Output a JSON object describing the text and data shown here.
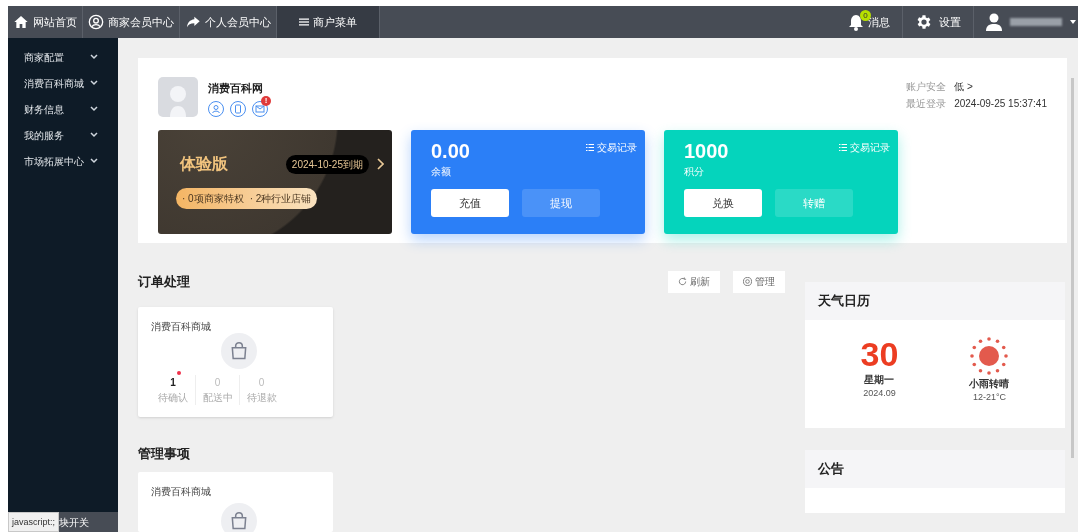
{
  "nav": {
    "left": [
      {
        "label": "网站首页",
        "selected": false
      },
      {
        "label": "商家会员中心",
        "selected": false
      },
      {
        "label": "个人会员中心",
        "selected": false
      },
      {
        "label": "商户菜单",
        "selected": true
      }
    ],
    "messages": {
      "label": "消息",
      "badge": "0"
    },
    "settings": {
      "label": "设置"
    }
  },
  "sidebar": {
    "items": [
      {
        "label": "商家配置"
      },
      {
        "label": "消费百科商城"
      },
      {
        "label": "财务信息"
      },
      {
        "label": "我的服务"
      },
      {
        "label": "市场拓展中心"
      }
    ],
    "bottom_item": "块开关"
  },
  "status_bar": "javascript:;",
  "profile": {
    "name": "消费百科网",
    "mail_alert": "!",
    "security": {
      "label": "账户安全",
      "value": "低 >"
    },
    "last_login": {
      "label": "最近登录",
      "value": "2024-09-25 15:37:41"
    }
  },
  "vip": {
    "title": "体验版",
    "expiry": "2024-10-25到期",
    "perks": [
      "· 0项商家特权",
      "· 2种行业店铺"
    ]
  },
  "wallets": [
    {
      "amount": "0.00",
      "label": "余额",
      "record_link": "交易记录",
      "buttons": [
        "充值",
        "提现"
      ],
      "color": "#2b7ff7"
    },
    {
      "amount": "1000",
      "label": "积分",
      "record_link": "交易记录",
      "buttons": [
        "兑换",
        "转赠"
      ],
      "color": "#05d4bc"
    }
  ],
  "orders": {
    "title": "订单处理",
    "actions": [
      "刷新",
      "管理"
    ],
    "store": "消费百科商城",
    "stats": [
      {
        "value": "1",
        "label": "待确认",
        "alert": true
      },
      {
        "value": "0",
        "label": "配送中",
        "alert": false
      },
      {
        "value": "0",
        "label": "待退款",
        "alert": false
      }
    ]
  },
  "manage": {
    "title": "管理事项",
    "store": "消费百科商城"
  },
  "weather": {
    "title": "天气日历",
    "day": "30",
    "weekday": "星期一",
    "month": "2024.09",
    "condition": "小雨转晴",
    "temperature": "12-21°C"
  },
  "notice": {
    "title": "公告"
  }
}
